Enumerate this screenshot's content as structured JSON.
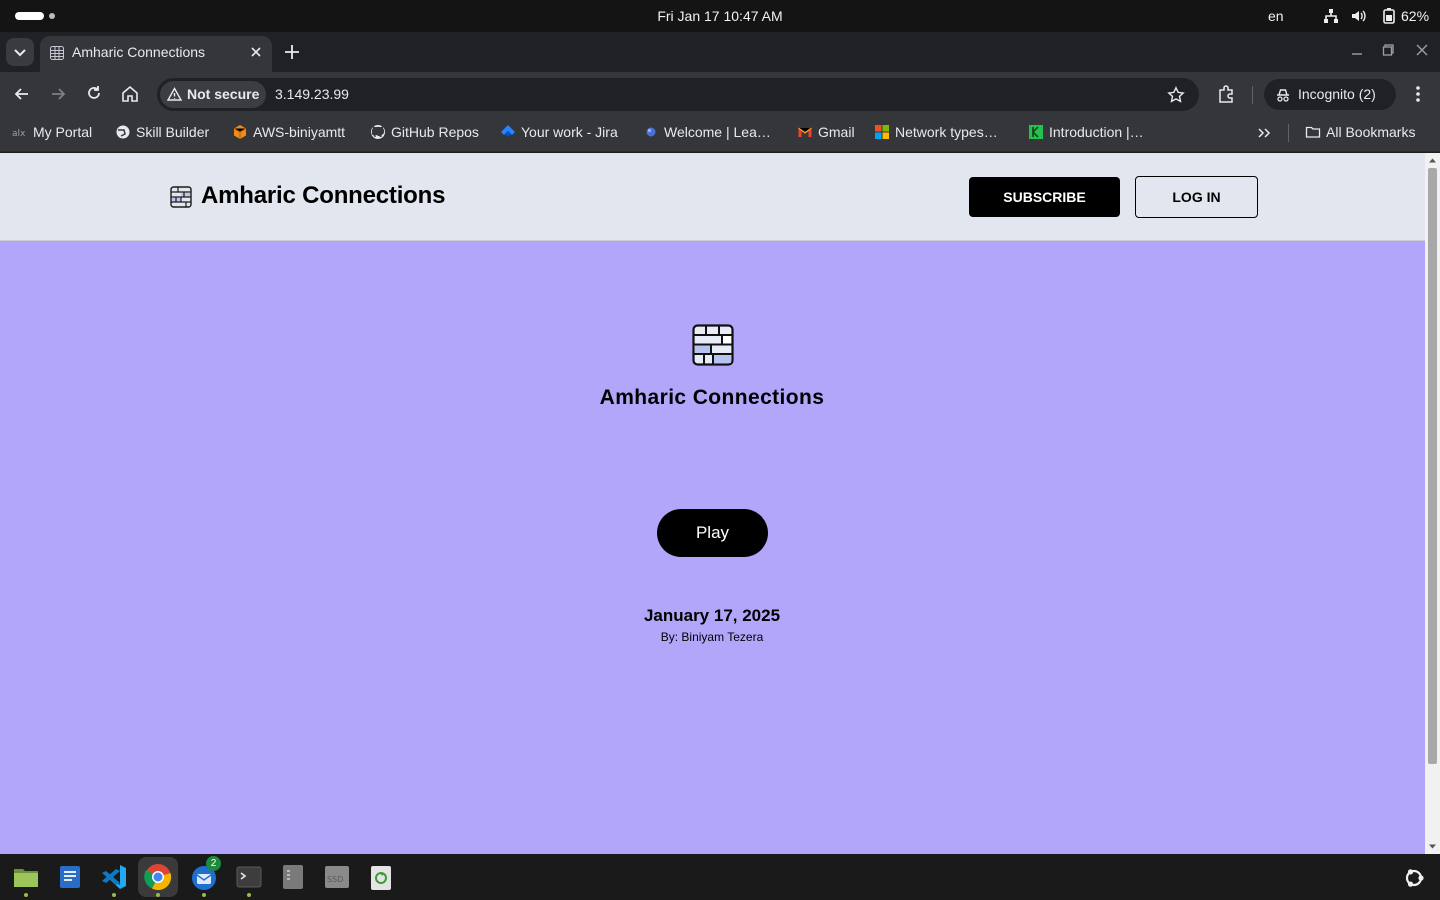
{
  "system": {
    "clock": "Fri Jan 17  10:47 AM",
    "language": "en",
    "battery": "62%"
  },
  "browser": {
    "tab": {
      "title": "Amharic Connections"
    },
    "address": {
      "security_label": "Not secure",
      "url": "3.149.23.99"
    },
    "profile_label": "Incognito (2)",
    "bookmarks": [
      {
        "label": "My Portal",
        "icon": "alx-icon"
      },
      {
        "label": "Skill Builder",
        "icon": "globe-icon"
      },
      {
        "label": "AWS-biniyamtt",
        "icon": "aws-box-icon"
      },
      {
        "label": "GitHub Repos",
        "icon": "github-icon"
      },
      {
        "label": "Your work - Jira",
        "icon": "jira-icon"
      },
      {
        "label": "Welcome | Lea…",
        "icon": "sphere-icon"
      },
      {
        "label": "Gmail",
        "icon": "gmail-icon"
      },
      {
        "label": "Network types…",
        "icon": "microsoft-icon"
      },
      {
        "label": "Introduction |…",
        "icon": "green-square-icon"
      }
    ],
    "all_bookmarks_label": "All Bookmarks"
  },
  "page": {
    "header": {
      "site_title": "Amharic Connections",
      "subscribe_label": "SUBSCRIBE",
      "login_label": "LOG IN"
    },
    "hero": {
      "title": "Amharic Connections",
      "play_label": "Play",
      "date": "January 17, 2025",
      "byline": "By: Biniyam Tezera"
    },
    "colors": {
      "background": "#b2a6fb",
      "header_background": "#e2e7ef",
      "button": "#000000"
    }
  },
  "dock": {
    "apps": [
      "files-icon",
      "text-editor-icon",
      "vscode-icon",
      "chrome-icon",
      "thunderbird-icon",
      "terminal-icon",
      "disk-icon",
      "ssd-icon",
      "trash-icon"
    ],
    "thunderbird_badge": "2",
    "ssd_label": "SSD"
  }
}
